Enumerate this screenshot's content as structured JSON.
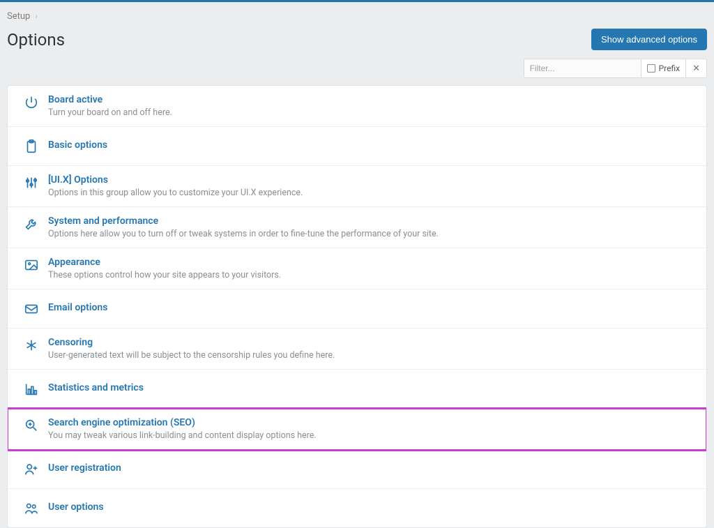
{
  "breadcrumb": {
    "item": "Setup"
  },
  "page": {
    "title": "Options"
  },
  "buttons": {
    "advanced": "Show advanced options"
  },
  "filter": {
    "placeholder": "Filter...",
    "prefix_label": "Prefix"
  },
  "rows": [
    {
      "title": "Board active",
      "desc": "Turn your board on and off here."
    },
    {
      "title": "Basic options",
      "desc": ""
    },
    {
      "title": "[UI.X] Options",
      "desc": "Options in this group allow you to customize your UI.X experience."
    },
    {
      "title": "System and performance",
      "desc": "Options here allow you to turn off or tweak systems in order to fine-tune the performance of your site."
    },
    {
      "title": "Appearance",
      "desc": "These options control how your site appears to your visitors."
    },
    {
      "title": "Email options",
      "desc": ""
    },
    {
      "title": "Censoring",
      "desc": "User-generated text will be subject to the censorship rules you define here."
    },
    {
      "title": "Statistics and metrics",
      "desc": ""
    },
    {
      "title": "Search engine optimization (SEO)",
      "desc": "You may tweak various link-building and content display options here."
    },
    {
      "title": "User registration",
      "desc": ""
    },
    {
      "title": "User options",
      "desc": ""
    }
  ]
}
